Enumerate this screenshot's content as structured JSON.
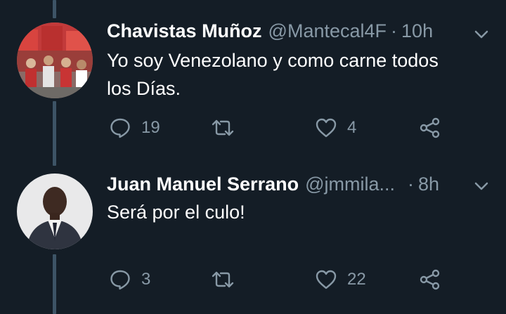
{
  "tweets": [
    {
      "name": "Chavistas Muñoz",
      "handle": "@Mantecal4F",
      "separator": "·",
      "time": "10h",
      "text_lines": [
        "Yo soy Venezolano y como carne todos",
        "los Días."
      ],
      "replies": "19",
      "retweets": "",
      "likes": "4"
    },
    {
      "name": "Juan Manuel Serrano",
      "handle": "@jmmila...",
      "separator": "·",
      "time": "8h",
      "text_lines": [
        "Será por el culo!"
      ],
      "replies": "3",
      "retweets": "",
      "likes": "22"
    }
  ],
  "icons": [
    "reply-icon",
    "retweet-icon",
    "like-icon",
    "share-icon",
    "chevron-down-icon"
  ],
  "colors": {
    "background": "#141d26",
    "muted": "#8899a6",
    "thread_line": "#3d5466",
    "text": "#ffffff"
  }
}
